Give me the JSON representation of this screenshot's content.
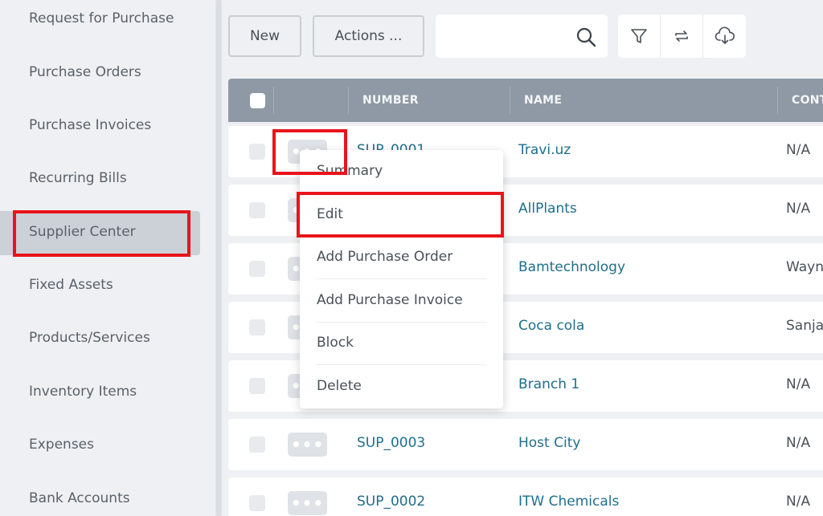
{
  "sidebar": {
    "items": [
      {
        "label": "Request for Purchase"
      },
      {
        "label": "Purchase Orders"
      },
      {
        "label": "Purchase Invoices"
      },
      {
        "label": "Recurring Bills"
      },
      {
        "label": "Supplier Center"
      },
      {
        "label": "Fixed Assets"
      },
      {
        "label": "Products/Services"
      },
      {
        "label": "Inventory Items"
      },
      {
        "label": "Expenses"
      },
      {
        "label": "Bank Accounts"
      }
    ],
    "active_index": 4
  },
  "toolbar": {
    "new_label": "New",
    "actions_label": "Actions ...",
    "search_value": "",
    "icons": [
      "search-icon",
      "filter-icon",
      "sync-icon",
      "cloud-download-icon"
    ]
  },
  "table": {
    "columns": [
      "NUMBER",
      "NAME",
      "CONT"
    ],
    "rows": [
      {
        "number": "SUP_0001",
        "name": "Travi.uz",
        "contact": "N/A"
      },
      {
        "number": "",
        "name": "AllPlants",
        "contact": "N/A"
      },
      {
        "number": "",
        "name": "Bamtechnology",
        "contact": "Wayn"
      },
      {
        "number": "",
        "name": "Coca cola",
        "contact": "Sanja"
      },
      {
        "number": "",
        "name": "Branch 1",
        "contact": "N/A"
      },
      {
        "number": "SUP_0003",
        "name": "Host City",
        "contact": "N/A"
      },
      {
        "number": "SUP_0002",
        "name": "ITW Chemicals",
        "contact": "N/A"
      }
    ],
    "row_actions_glyph": "•••"
  },
  "context_menu": {
    "items": [
      {
        "label": "Summary"
      },
      {
        "label": "Edit"
      },
      {
        "label": "Add Purchase Order"
      },
      {
        "label": "Add Purchase Invoice"
      },
      {
        "label": "Block"
      },
      {
        "label": "Delete"
      }
    ]
  },
  "colors": {
    "highlight": "#e8141c",
    "link": "#1f6e8c",
    "header": "#8e99a5",
    "sidebar_active": "#ccd1d8"
  }
}
